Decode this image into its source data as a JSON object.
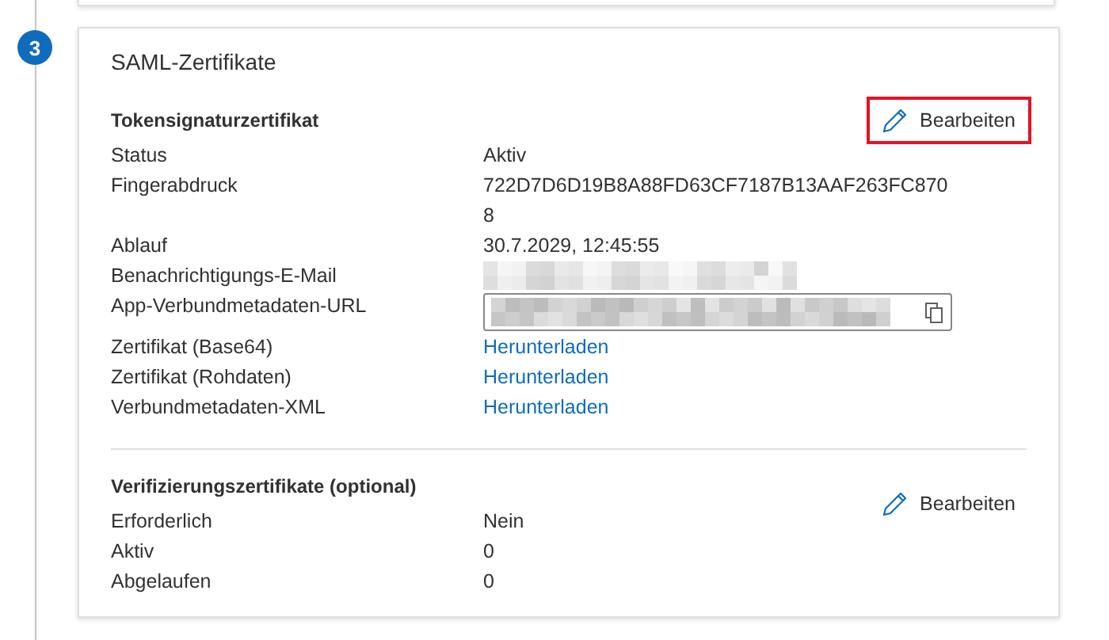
{
  "step": {
    "number": "3"
  },
  "card": {
    "title": "SAML-Zertifikate",
    "sections": [
      {
        "heading": "Tokensignaturzertifikat",
        "edit": {
          "label": "Bearbeiten",
          "highlighted": true
        },
        "rows": [
          {
            "label": "Status",
            "kind": "text",
            "value": "Aktiv"
          },
          {
            "label": "Fingerabdruck",
            "kind": "text",
            "value": "722D7D6D19B8A88FD63CF7187B13AAF263FC8708"
          },
          {
            "label": "Ablauf",
            "kind": "text",
            "value": "30.7.2029, 12:45:55"
          },
          {
            "label": "Benachrichtigungs-E-Mail",
            "kind": "redacted"
          },
          {
            "label": "App-Verbundmetadaten-URL",
            "kind": "field"
          },
          {
            "label": "Zertifikat (Base64)",
            "kind": "link",
            "value": "Herunterladen"
          },
          {
            "label": "Zertifikat (Rohdaten)",
            "kind": "link",
            "value": "Herunterladen"
          },
          {
            "label": "Verbundmetadaten-XML",
            "kind": "link",
            "value": "Herunterladen"
          }
        ]
      },
      {
        "heading": "Verifizierungszertifikate (optional)",
        "edit": {
          "label": "Bearbeiten",
          "highlighted": false
        },
        "rows": [
          {
            "label": "Erforderlich",
            "kind": "text",
            "value": "Nein"
          },
          {
            "label": "Aktiv",
            "kind": "text",
            "value": "0"
          },
          {
            "label": "Abgelaufen",
            "kind": "text",
            "value": "0"
          }
        ]
      }
    ]
  }
}
